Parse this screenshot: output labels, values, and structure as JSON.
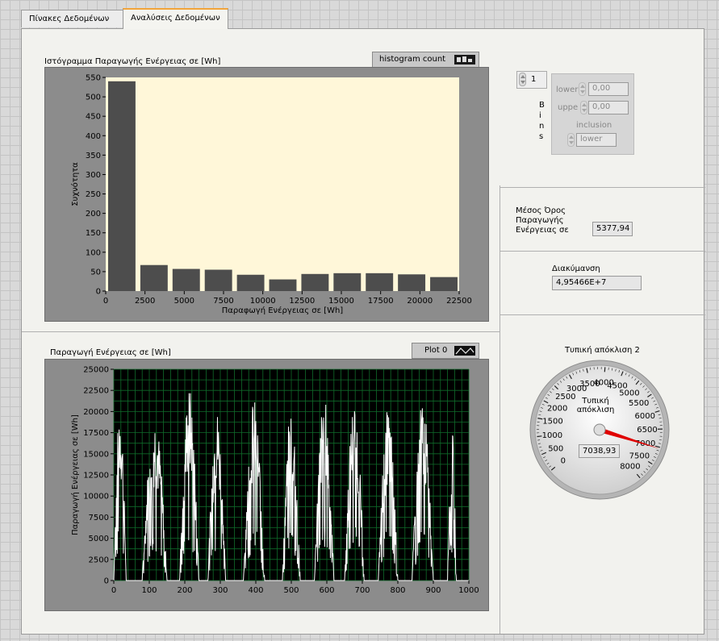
{
  "tabs": [
    {
      "label": "Πίνακες Δεδομένων"
    },
    {
      "label": "Αναλύσεις Δεδομένων"
    }
  ],
  "histogram": {
    "title": "Ιστόγραμμα Παραγωγής Ενέργειας σε [Wh]",
    "legend_label": "histogram count",
    "plot_bg": "#fff7d9",
    "bar_color": "#4d4d4d"
  },
  "line_graph": {
    "title": "Παραγωγή Ενέργειας σε [Wh]",
    "legend_label": "Plot 0",
    "plot_bg": "#000000",
    "grid_color": "#0f6b2a",
    "line_color": "#ffffff"
  },
  "bins_control": {
    "value": "1",
    "label": "Bins",
    "lower_label": "lower",
    "lower_value": "0,00",
    "upper_label": "uppe",
    "upper_value": "0,00",
    "inclusion_label": "inclusion",
    "inclusion_value": "lower"
  },
  "mean": {
    "label": "Μέσος Όρος Παραγωγής Ενέργειας σε",
    "value": "5377,94"
  },
  "variance": {
    "label": "Διακύμανση",
    "value": "4,95466E+7"
  },
  "std_gauge": {
    "title": "Τυπική απόκλιση 2",
    "inner_label": "Τυπική απόκλιση",
    "value_text": "7038,93",
    "value": 7038.93,
    "min": 0,
    "max": 8000,
    "needle_color": "#e00000",
    "scale_labels": [
      "0",
      "500",
      "1000",
      "1500",
      "2000",
      "2500",
      "3000",
      "3500",
      "4000",
      "4500",
      "5000",
      "5500",
      "6000",
      "6500",
      "7000",
      "7500",
      "8000"
    ]
  },
  "chart_data": [
    {
      "type": "bar",
      "title": "Ιστόγραμμα Παραγωγής Ενέργειας σε [Wh]",
      "xlabel": "Παραφωγή Ενέργειας σε [Wh]",
      "ylabel": "Συχνότητα",
      "xlim": [
        0,
        22500
      ],
      "ylim": [
        0,
        550
      ],
      "x_ticks": [
        "0",
        "2500",
        "5000",
        "7500",
        "10000",
        "12500",
        "15000",
        "17500",
        "20000",
        "22500"
      ],
      "y_ticks": [
        "0",
        "50",
        "100",
        "150",
        "200",
        "250",
        "300",
        "350",
        "400",
        "450",
        "500",
        "550"
      ],
      "bin_width": 2050,
      "bin_starts": [
        0,
        2050,
        4100,
        6150,
        8200,
        10250,
        12300,
        14350,
        16400,
        18450,
        20500
      ],
      "values": [
        540,
        67,
        57,
        55,
        42,
        30,
        44,
        46,
        46,
        43,
        36
      ],
      "series": [
        {
          "name": "histogram count",
          "values": [
            540,
            67,
            57,
            55,
            42,
            30,
            44,
            46,
            46,
            43,
            36
          ]
        }
      ]
    },
    {
      "type": "line",
      "title": "Παραγωγή Ενέργειας σε [Wh]",
      "xlabel": "",
      "ylabel": "Παραγωγή Ενέργειας σε [Wh]",
      "xlim": [
        0,
        1000
      ],
      "ylim": [
        0,
        25000
      ],
      "x_ticks": [
        "0",
        "100",
        "200",
        "300",
        "400",
        "500",
        "600",
        "700",
        "800",
        "900",
        "1000"
      ],
      "y_ticks": [
        "0",
        "2500",
        "5000",
        "7500",
        "10000",
        "12500",
        "15000",
        "17500",
        "20000",
        "22500",
        "25000"
      ],
      "series": [
        {
          "name": "Plot 0",
          "peaks": [
            {
              "start": 0,
              "end": 35,
              "max": 21500
            },
            {
              "start": 80,
              "end": 150,
              "max": 20000
            },
            {
              "start": 185,
              "end": 240,
              "max": 23000
            },
            {
              "start": 265,
              "end": 315,
              "max": 20500
            },
            {
              "start": 365,
              "end": 425,
              "max": 21500
            },
            {
              "start": 475,
              "end": 525,
              "max": 21000
            },
            {
              "start": 565,
              "end": 620,
              "max": 22000
            },
            {
              "start": 650,
              "end": 705,
              "max": 21500
            },
            {
              "start": 745,
              "end": 800,
              "max": 20500
            },
            {
              "start": 840,
              "end": 900,
              "max": 21500
            },
            {
              "start": 940,
              "end": 965,
              "max": 18000
            }
          ]
        }
      ]
    }
  ]
}
